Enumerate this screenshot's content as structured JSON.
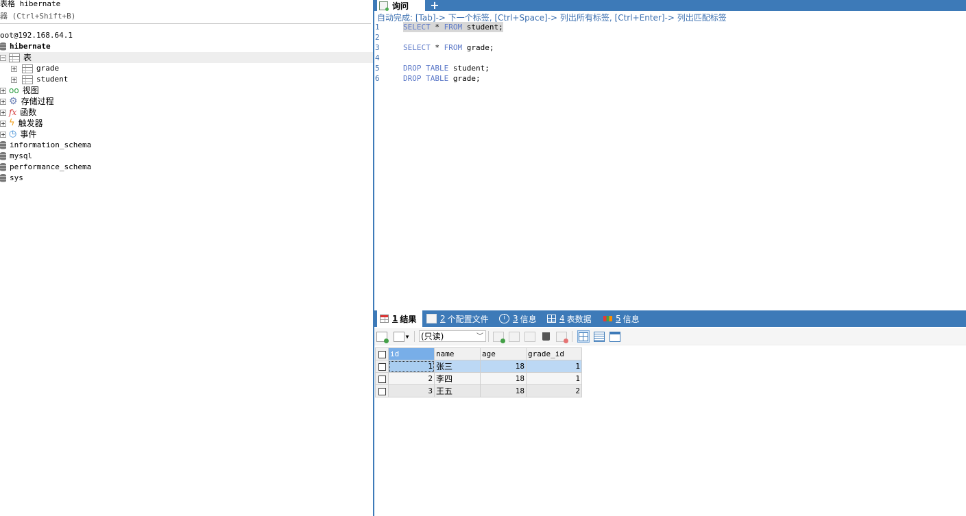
{
  "left": {
    "header": "表格 hibernate",
    "filter_placeholder": "器 (Ctrl+Shift+B)",
    "connection": "oot@192.168.64.1",
    "database": "hibernate",
    "tree": {
      "tables_label": "表",
      "tables": [
        "grade",
        "student"
      ],
      "views_label": "视图",
      "procedures_label": "存储过程",
      "functions_label": "函数",
      "triggers_label": "触发器",
      "events_label": "事件"
    },
    "other_databases": [
      "information_schema",
      "mysql",
      "performance_schema",
      "sys"
    ]
  },
  "query": {
    "tab_label": "询问",
    "add_tab_label": "+",
    "autocomplete_hint": "自动完成: [Tab]-> 下一个标签, [Ctrl+Space]-> 列出所有标签, [Ctrl+Enter]-> 列出匹配标签",
    "line_numbers": [
      "1",
      "2",
      "3",
      "4",
      "5",
      "6"
    ],
    "lines": [
      {
        "kw1": "SELECT",
        "op": " * ",
        "kw2": "FROM",
        "rest": " student;"
      },
      {
        "kw1": "SELECT",
        "op": " * ",
        "kw2": "FROM",
        "rest": " grade;"
      },
      {
        "kw1": "DROP TABLE",
        "rest": " student;"
      },
      {
        "kw1": "DROP TABLE",
        "rest": " grade;"
      }
    ]
  },
  "results": {
    "tabs": [
      {
        "num": "1",
        "label": "结果"
      },
      {
        "num": "2",
        "label": "个配置文件"
      },
      {
        "num": "3",
        "label": "信息"
      },
      {
        "num": "4",
        "label": "表数据"
      },
      {
        "num": "5",
        "label": "信息"
      }
    ],
    "readonly_label": "(只读)",
    "columns": [
      "id",
      "name",
      "age",
      "grade_id"
    ],
    "rows": [
      {
        "id": "1",
        "name": "张三",
        "age": "18",
        "grade_id": "1"
      },
      {
        "id": "2",
        "name": "李四",
        "age": "18",
        "grade_id": "1"
      },
      {
        "id": "3",
        "name": "王五",
        "age": "18",
        "grade_id": "2"
      }
    ]
  },
  "colors": {
    "accent_blue": "#3d7ab8",
    "keyword": "#5b78c8",
    "selection": "#bcd8f4"
  },
  "icons": {
    "database": "database-icon",
    "table": "table-icon",
    "view": "glasses-icon",
    "procedure": "gear-icon",
    "function": "function-icon",
    "trigger": "lightning-icon",
    "event": "clock-icon"
  }
}
